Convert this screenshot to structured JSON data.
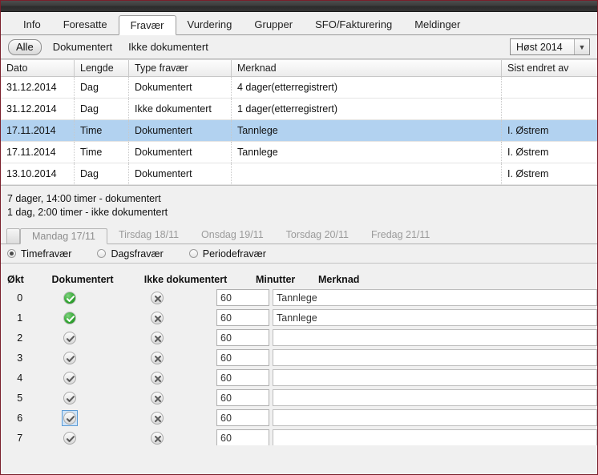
{
  "window": {
    "title": ""
  },
  "main_tabs": [
    {
      "label": "Info",
      "active": false
    },
    {
      "label": "Foresatte",
      "active": false
    },
    {
      "label": "Fravær",
      "active": true
    },
    {
      "label": "Vurdering",
      "active": false
    },
    {
      "label": "Grupper",
      "active": false
    },
    {
      "label": "SFO/Fakturering",
      "active": false
    },
    {
      "label": "Meldinger",
      "active": false
    }
  ],
  "filter": {
    "all_label": "Alle",
    "documented_label": "Dokumentert",
    "undocumented_label": "Ikke dokumentert",
    "term_value": "Høst 2014",
    "term_arrow": "chevron-down-icon"
  },
  "grid": {
    "columns": [
      "Dato",
      "Lengde",
      "Type fravær",
      "Merknad",
      "Sist endret av"
    ],
    "rows": [
      {
        "dato": "31.12.2014",
        "lengde": "Dag",
        "type": "Dokumentert",
        "merknad": "4 dager(etterregistrert)",
        "sist": "",
        "selected": false
      },
      {
        "dato": "31.12.2014",
        "lengde": "Dag",
        "type": "Ikke dokumentert",
        "merknad": "1 dager(etterregistrert)",
        "sist": "",
        "selected": false
      },
      {
        "dato": "17.11.2014",
        "lengde": "Time",
        "type": "Dokumentert",
        "merknad": "Tannlege",
        "sist": "I. Østrem",
        "selected": true
      },
      {
        "dato": "17.11.2014",
        "lengde": "Time",
        "type": "Dokumentert",
        "merknad": "Tannlege",
        "sist": "I. Østrem",
        "selected": false
      },
      {
        "dato": "13.10.2014",
        "lengde": "Dag",
        "type": "Dokumentert",
        "merknad": "",
        "sist": "I. Østrem",
        "selected": false
      }
    ]
  },
  "summary": {
    "line1": "7 dager, 14:00 timer - dokumentert",
    "line2": "1 dag, 2:00 timer - ikke dokumentert"
  },
  "day_tabs": [
    {
      "label": "Mandag 17/11",
      "active": true
    },
    {
      "label": "Tirsdag 18/11",
      "active": false
    },
    {
      "label": "Onsdag 19/11",
      "active": false
    },
    {
      "label": "Torsdag 20/11",
      "active": false
    },
    {
      "label": "Fredag 21/11",
      "active": false
    }
  ],
  "absence_type_radios": [
    {
      "label": "Timefravær",
      "selected": true
    },
    {
      "label": "Dagsfravær",
      "selected": false
    },
    {
      "label": "Periodefravær",
      "selected": false
    }
  ],
  "sessions": {
    "columns": [
      "Økt",
      "Dokumentert",
      "Ikke dokumentert",
      "Minutter",
      "Merknad"
    ],
    "rows": [
      {
        "okt": "0",
        "dokumentert_icon": "check-circle-green-icon",
        "dokumentert_state": "on",
        "dokumentert_focused": false,
        "ikke_icon": "cross-circle-gray-icon",
        "minutter": "60",
        "merknad": "Tannlege"
      },
      {
        "okt": "1",
        "dokumentert_icon": "check-circle-green-icon",
        "dokumentert_state": "on",
        "dokumentert_focused": false,
        "ikke_icon": "cross-circle-gray-icon",
        "minutter": "60",
        "merknad": "Tannlege"
      },
      {
        "okt": "2",
        "dokumentert_icon": "check-circle-gray-icon",
        "dokumentert_state": "off",
        "dokumentert_focused": false,
        "ikke_icon": "cross-circle-gray-icon",
        "minutter": "60",
        "merknad": ""
      },
      {
        "okt": "3",
        "dokumentert_icon": "check-circle-gray-icon",
        "dokumentert_state": "off",
        "dokumentert_focused": false,
        "ikke_icon": "cross-circle-gray-icon",
        "minutter": "60",
        "merknad": ""
      },
      {
        "okt": "4",
        "dokumentert_icon": "check-circle-gray-icon",
        "dokumentert_state": "off",
        "dokumentert_focused": false,
        "ikke_icon": "cross-circle-gray-icon",
        "minutter": "60",
        "merknad": ""
      },
      {
        "okt": "5",
        "dokumentert_icon": "check-circle-gray-icon",
        "dokumentert_state": "off",
        "dokumentert_focused": false,
        "ikke_icon": "cross-circle-gray-icon",
        "minutter": "60",
        "merknad": ""
      },
      {
        "okt": "6",
        "dokumentert_icon": "check-circle-gray-icon",
        "dokumentert_state": "off",
        "dokumentert_focused": true,
        "ikke_icon": "cross-circle-gray-icon",
        "minutter": "60",
        "merknad": ""
      },
      {
        "okt": "7",
        "dokumentert_icon": "check-circle-gray-icon",
        "dokumentert_state": "off",
        "dokumentert_focused": false,
        "ikke_icon": "cross-circle-gray-icon",
        "minutter": "60",
        "merknad": ""
      }
    ]
  },
  "colors": {
    "selected_row": "#b2d2f0",
    "green_check": "#35a735",
    "window_border": "#7a1f2b",
    "panel_bg": "#f0f0f0",
    "focus_blue": "#5b9bd5"
  }
}
